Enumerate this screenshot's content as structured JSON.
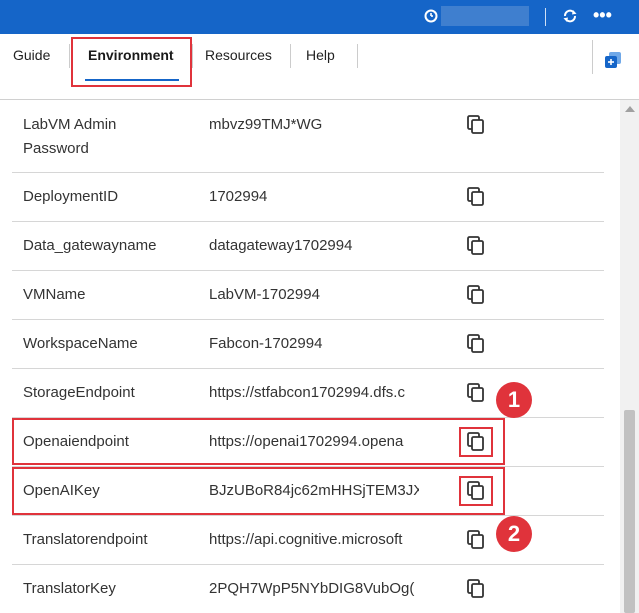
{
  "header": {
    "timer_icon": "clock-icon",
    "refresh_icon": "refresh-icon",
    "more_icon": "more-icon",
    "more_glyph": "•••"
  },
  "tabs": [
    {
      "label": "Guide"
    },
    {
      "label": "Environment"
    },
    {
      "label": "Resources"
    },
    {
      "label": "Help"
    }
  ],
  "rows": [
    {
      "label": "LabVM Admin Password",
      "value": "mbvz99TMJ*WG"
    },
    {
      "label": "DeploymentID",
      "value": "1702994"
    },
    {
      "label": "Data_gatewayname",
      "value": "datagateway1702994"
    },
    {
      "label": "VMName",
      "value": "LabVM-1702994"
    },
    {
      "label": "WorkspaceName",
      "value": "Fabcon-1702994"
    },
    {
      "label": "StorageEndpoint",
      "value": "https://stfabcon1702994.dfs.c"
    },
    {
      "label": "Openaiendpoint",
      "value": "https://openai1702994.opena"
    },
    {
      "label": "OpenAIKey",
      "value": "BJzUBoR84jc62mHHSjTEM3JX"
    },
    {
      "label": "Translatorendpoint",
      "value": "https://api.cognitive.microsoft"
    },
    {
      "label": "TranslatorKey",
      "value": "2PQH7WpP5NYbDIG8VubOg("
    }
  ],
  "annotations": [
    {
      "label": "1"
    },
    {
      "label": "2"
    }
  ],
  "colors": {
    "accent": "#1565c8",
    "highlight": "#e0333b"
  }
}
